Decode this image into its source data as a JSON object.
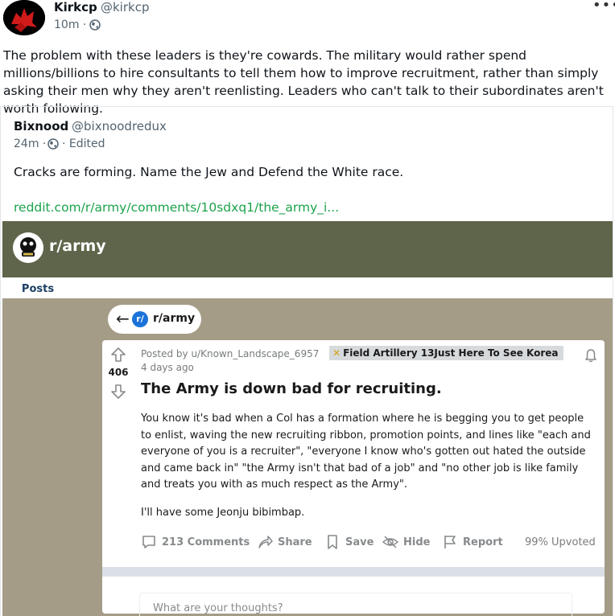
{
  "post": {
    "author_name": "Kirkcp",
    "author_handle": "@kirkcp",
    "time": "10m",
    "separator": "·",
    "more_label": "•••",
    "text": "The problem with these leaders is they're cowards. The military would rather spend millions/billions to hire consultants to tell them how to improve recruitment, rather than simply asking their men why they aren't reenlisting. Leaders who can't talk to their subordinates aren't worth following."
  },
  "quote": {
    "author_name": "Bixnood",
    "author_handle": "@bixnoodredux",
    "time": "24m",
    "separator": "·",
    "edited": "· Edited",
    "text": "Cracks are forming. Name the Jew and Defend the White race.",
    "link": "reddit.com/r/army/comments/10sdxq1/the_army_i..."
  },
  "reddit": {
    "subreddit": "r/army",
    "tab": "Posts",
    "back_pill_label": "r/army",
    "pill_logo_text": "r/",
    "vote_count": "406",
    "posted_by": "Posted by u/Known_Landscape_6957",
    "flair_icon": "✕",
    "flair": "Field Artillery 13Just Here To See Korea",
    "age": "4 days ago",
    "title": "The Army is down bad for recruiting.",
    "body": "You know it's bad when a Col has a formation where he is begging you to get people to enlist, waving the new recruiting ribbon, promotion points, and lines like \"each and everyone of you is a recruiter\", \"everyone I know who's gotten out hated the outside and came back in\" \"the Army isn't that bad of a job\" and \"no other job is like family and treats you with as much respect as the Army\".",
    "body2": "I'll have some Jeonju bibimbap.",
    "actions": {
      "comments": "213 Comments",
      "share": "Share",
      "save": "Save",
      "hide": "Hide",
      "report": "Report"
    },
    "upvoted": "99% Upvoted",
    "comment_placeholder": "What are your thoughts?"
  },
  "colors": {
    "banner": "#5f654a",
    "tan": "#a49c87",
    "link_green": "#1ba34a",
    "tab_blue": "#1c3f63"
  }
}
